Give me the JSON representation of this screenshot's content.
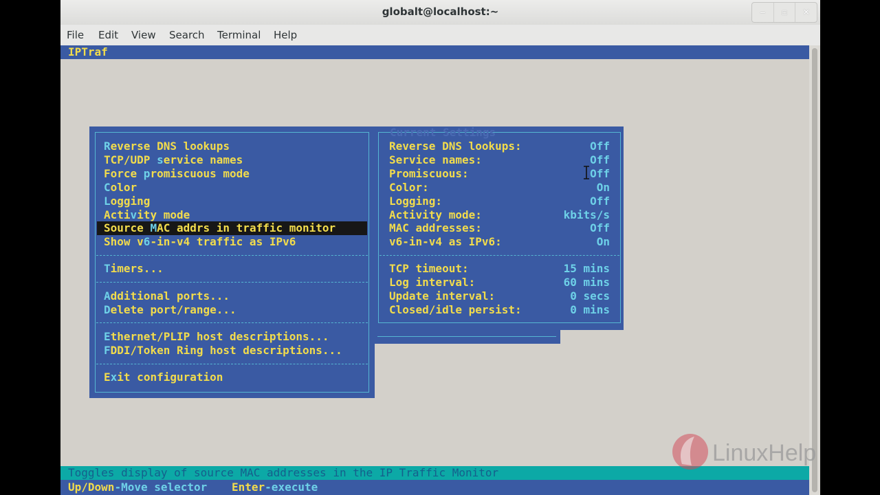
{
  "window": {
    "title": "globalt@localhost:~",
    "buttons": {
      "minimize": "‒",
      "maximize": "▫",
      "close": "✕"
    }
  },
  "menubar": {
    "items": [
      "File",
      "Edit",
      "View",
      "Search",
      "Terminal",
      "Help"
    ]
  },
  "terminal": {
    "app_title": "IPTraf",
    "menu": {
      "items": [
        {
          "hot": "R",
          "rest": "everse DNS lookups"
        },
        {
          "pre": "TCP/UDP ",
          "hot": "s",
          "rest": "ervice names"
        },
        {
          "pre": "Force ",
          "hot": "p",
          "rest": "romiscuous mode"
        },
        {
          "hot": "C",
          "rest": "olor"
        },
        {
          "hot": "L",
          "rest": "ogging"
        },
        {
          "pre": "Acti",
          "hot": "v",
          "rest": "ity mode"
        },
        {
          "pre": "Source ",
          "hot": "M",
          "rest": "AC addrs in traffic monitor",
          "selected": true
        },
        {
          "pre": "Show v",
          "hot": "6",
          "rest": "-in-v4 traffic as IPv6"
        },
        {
          "hot": "T",
          "rest": "imers..."
        },
        {
          "hot": "A",
          "rest": "dditional ports..."
        },
        {
          "hot": "D",
          "rest": "elete port/range..."
        },
        {
          "hot": "E",
          "rest": "thernet/PLIP host descriptions..."
        },
        {
          "hot": "F",
          "rest": "DDI/Token Ring host descriptions..."
        },
        {
          "pre": "E",
          "hot": "x",
          "rest": "it configuration"
        }
      ]
    },
    "settings": {
      "heading": "Current Settings",
      "rows": [
        {
          "label": "Reverse DNS lookups:",
          "value": "Off"
        },
        {
          "label": "Service names:",
          "value": "Off"
        },
        {
          "label": "Promiscuous:",
          "value": "Off"
        },
        {
          "label": "Color:",
          "value": "On"
        },
        {
          "label": "Logging:",
          "value": "Off"
        },
        {
          "label": "Activity mode:",
          "value": "kbits/s"
        },
        {
          "label": "MAC addresses:",
          "value": "Off"
        },
        {
          "label": "v6-in-v4 as IPv6:",
          "value": "On"
        },
        {
          "label": "TCP timeout:",
          "value": "15 mins"
        },
        {
          "label": "Log interval:",
          "value": "60 mins"
        },
        {
          "label": "Update interval:",
          "value": "0 secs"
        },
        {
          "label": "Closed/idle persist:",
          "value": "0 mins"
        }
      ]
    },
    "status": "Toggles display of source MAC addresses in the IP Traffic Monitor",
    "keys": [
      {
        "key": "Up/Down",
        "desc": "-Move selector"
      },
      {
        "key": "Enter",
        "desc": "-execute"
      }
    ]
  },
  "watermark": {
    "text": "LinuxHelp"
  },
  "colors": {
    "terminal_bg": "#d3d0ca",
    "dialog_blue": "#3a5aa3",
    "highlight_yellow": "#f2dc4c",
    "value_cyan": "#6ed1e8",
    "status_teal": "#0ca9a6"
  }
}
